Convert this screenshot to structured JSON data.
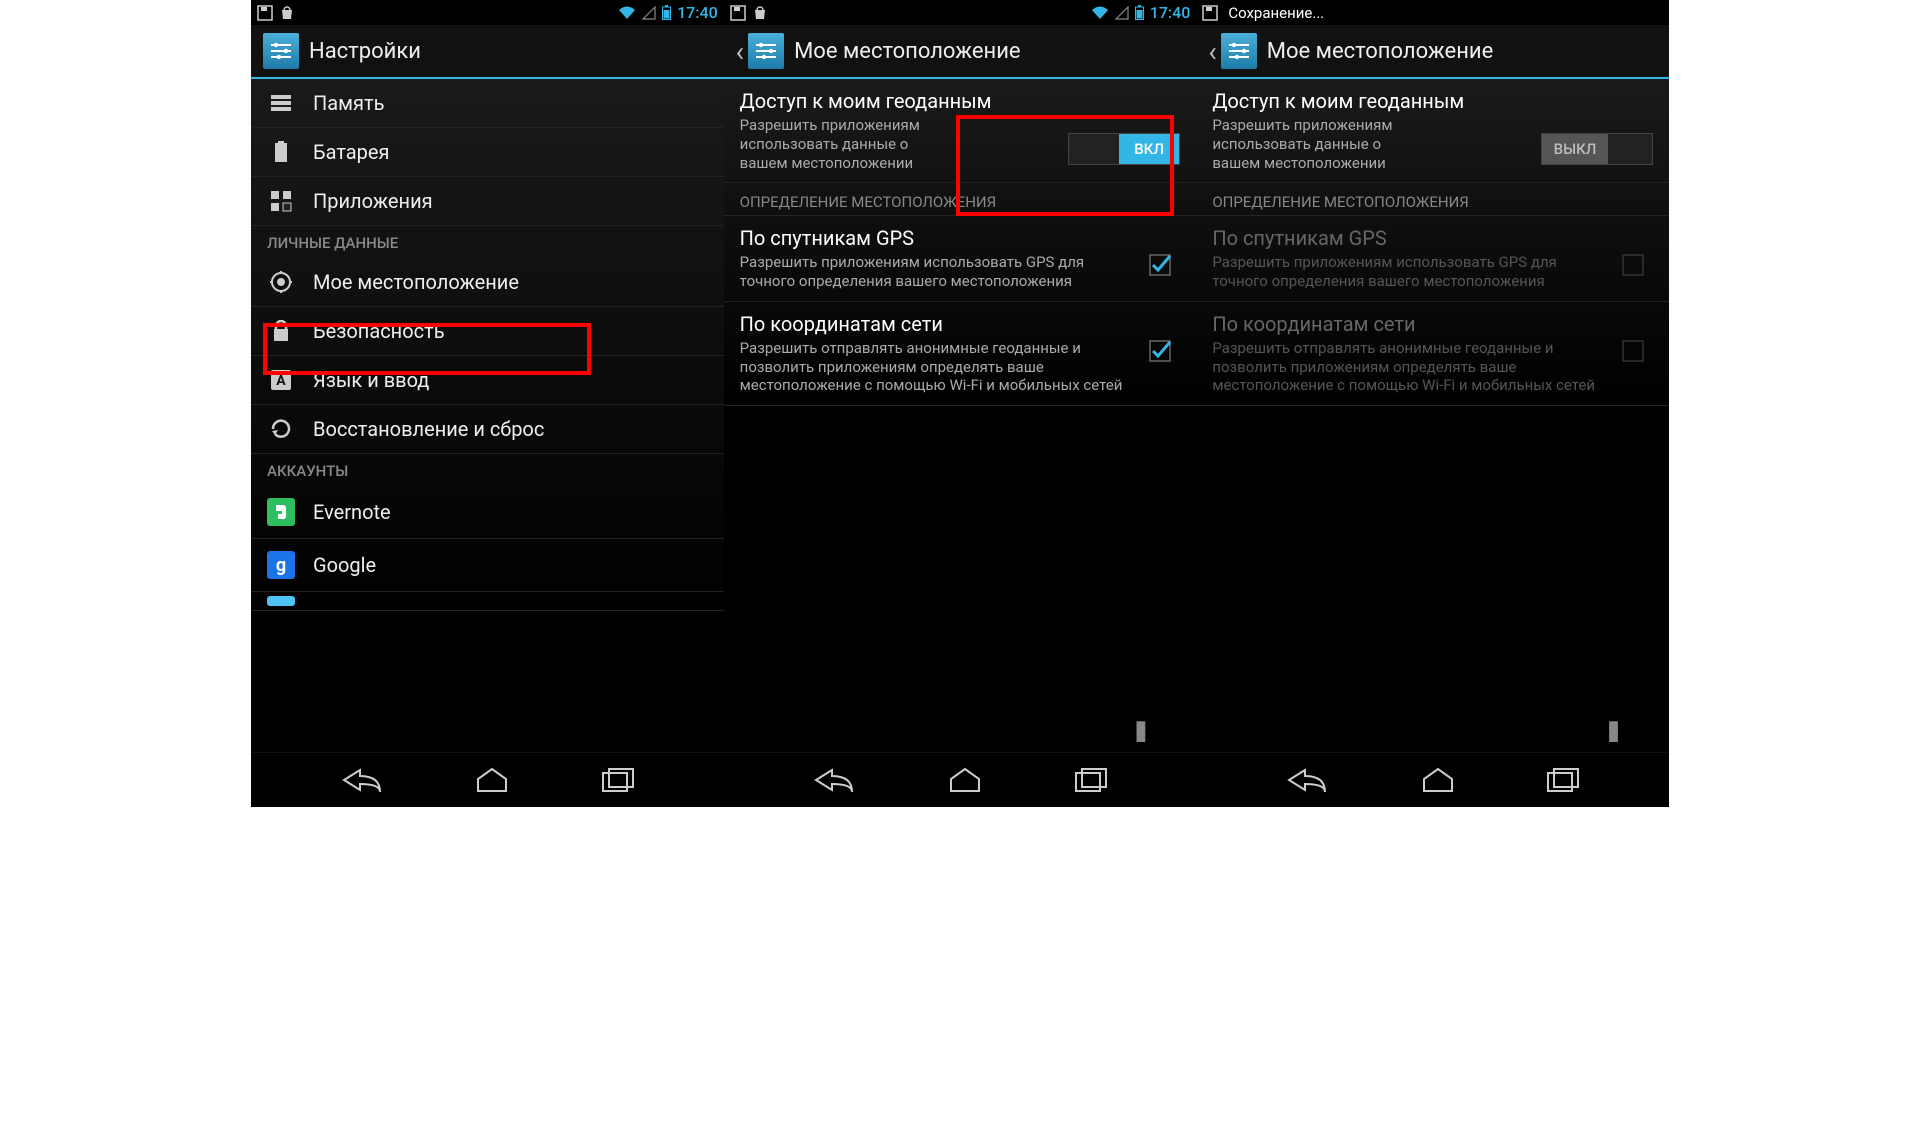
{
  "status": {
    "time": "17:40",
    "saving": "Сохранение..."
  },
  "screen1": {
    "title": "Настройки",
    "items": [
      {
        "label": "Память"
      },
      {
        "label": "Батарея"
      },
      {
        "label": "Приложения"
      }
    ],
    "sec_personal": "ЛИЧНЫЕ ДАННЫЕ",
    "personal": [
      {
        "label": "Мое местоположение"
      },
      {
        "label": "Безопасность"
      },
      {
        "label": "Язык и ввод"
      },
      {
        "label": "Восстановление и сброс"
      }
    ],
    "sec_accounts": "АККАУНТЫ",
    "accounts": [
      {
        "label": "Evernote"
      },
      {
        "label": "Google"
      }
    ]
  },
  "screen2": {
    "title": "Мое местоположение",
    "access_title": "Доступ к моим геоданным",
    "access_desc": "Разрешить приложениям использовать данные о вашем местоположении",
    "switch_on": "ВКЛ",
    "sec_sources": "ОПРЕДЕЛЕНИЕ МЕСТОПОЛОЖЕНИЯ",
    "gps_title": "По спутникам GPS",
    "gps_desc": "Разрешить приложениям использовать GPS для точного определения вашего местоположения",
    "net_title": "По координатам сети",
    "net_desc": "Разрешить отправлять анонимные геоданные и позволить приложениям определять ваше местоположение с помощью Wi-Fi и мобильных сетей"
  },
  "screen3": {
    "title": "Мое местоположение",
    "access_title": "Доступ к моим геоданным",
    "access_desc": "Разрешить приложениям использовать данные о вашем местоположении",
    "switch_off": "ВЫКЛ",
    "sec_sources": "ОПРЕДЕЛЕНИЕ МЕСТОПОЛОЖЕНИЯ",
    "gps_title": "По спутникам GPS",
    "gps_desc": "Разрешить приложениям использовать GPS для точного определения вашего местоположения",
    "net_title": "По координатам сети",
    "net_desc": "Разрешить отправлять анонимные геоданные и позволить приложениям определять ваше местоположение с помощью Wi-Fi и мобильных сетей"
  }
}
